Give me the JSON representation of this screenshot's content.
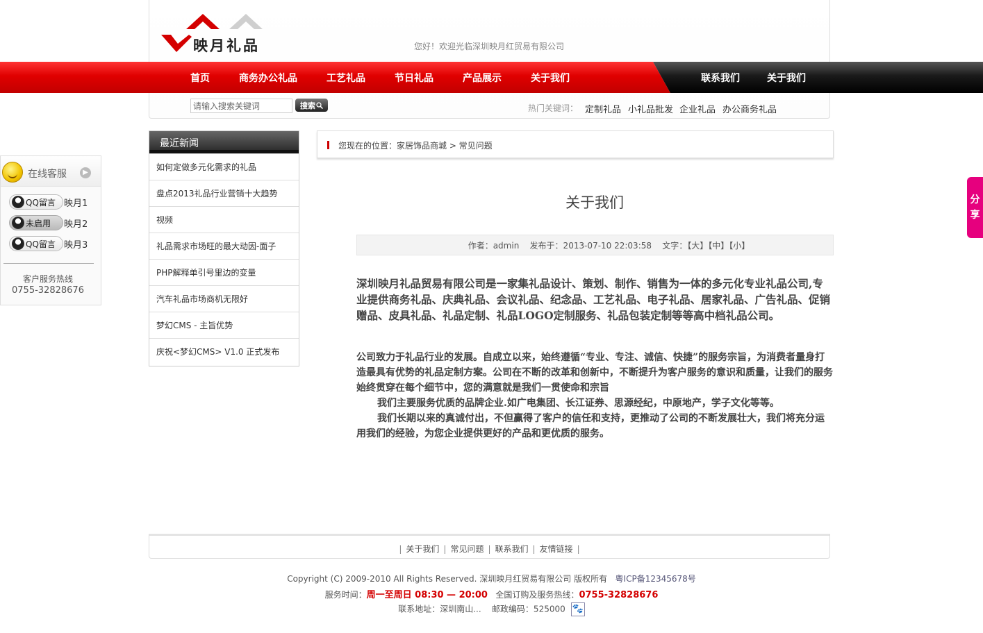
{
  "header": {
    "logo_text": "映月礼品",
    "welcome": "您好！欢迎光临深圳映月红贸易有限公司"
  },
  "nav": {
    "items": [
      "首页",
      "商务办公礼品",
      "工艺礼品",
      "节日礼品",
      "产品展示",
      "关于我们"
    ],
    "right_items": [
      "联系我们",
      "关于我们"
    ]
  },
  "search": {
    "placeholder": "请输入搜索关键词",
    "button": "搜索",
    "hot_label": "热门关键词：",
    "hot_words": [
      "定制礼品",
      "小礼品批发",
      "企业礼品",
      "办公商务礼品"
    ]
  },
  "news": {
    "title": "最近新闻",
    "items": [
      "如何定做多元化需求的礼品",
      "盘点2013礼品行业营销十大趋势",
      "视频",
      "礼品需求市场旺的最大动因-面子",
      "PHP解释单引号里边的变量",
      "汽车礼品市场商机无限好",
      "梦幻CMS - 主旨优势",
      "庆祝<梦幻CMS> V1.0 正式发布"
    ]
  },
  "breadcrumb": {
    "text": "您现在的位置：家居饰品商城 > 常见问题"
  },
  "article": {
    "title": "关于我们",
    "meta": "作者：admin    发布于：2013-07-10 22:03:58    文字：【大】【中】【小】",
    "para1": "深圳映月礼品贸易有限公司是一家集礼品设计、策划、制作、销售为一体的多元化专业礼品公司,专业提供商务礼品、庆典礼品、会议礼品、纪念品、工艺礼品、电子礼品、居家礼品、广告礼品、促销赠品、皮具礼品、礼品定制、礼品LOGO定制服务、礼品包装定制等等高中档礼品公司。",
    "para2": "公司致力于礼品行业的发展。自成立以来，始终遵循“专业、专注、诚信、快捷”的服务宗旨，为消费者量身打造最具有优势的礼品定制方案。公司在不断的改革和创新中，不断提升为客户服务的意识和质量，让我们的服务始终贯穿在每个细节中，您的满意就是我们一贯使命和宗旨",
    "para3": "我们主要服务优质的品牌企业.如广电集团、长江证券、思源经纪，中原地产，学子文化等等。",
    "para4": "我们长期以来的真诚付出，不但赢得了客户的信任和支持，更推动了公司的不断发展壮大，我们将充分运用我们的经验，为您企业提供更好的产品和更优质的服务。"
  },
  "online": {
    "title": "在线客服",
    "contacts": [
      {
        "button": "QQ留言",
        "name": "映月1"
      },
      {
        "button": "未启用",
        "name": "映月2"
      },
      {
        "button": "QQ留言",
        "name": "映月3"
      }
    ],
    "hotline_label": "客户服务热线",
    "hotline": "0755-32828676"
  },
  "share": {
    "chars": [
      "分",
      "享"
    ]
  },
  "footer": {
    "links": [
      "关于我们",
      "常见问题",
      "联系我们",
      "友情链接"
    ],
    "copyright": "Copyright (C) 2009-2010 All Rights Reserved. 深圳映月红贸易有限公司 版权所有",
    "icp": "粤ICP备12345678号",
    "hours_label": "服务时间：",
    "hours": "周一至周日 08:30 — 20:00",
    "phone_label": "全国订购及服务热线：",
    "phone": "0755-32828676",
    "address": "联系地址：深圳南山...    邮政编码：525000"
  }
}
